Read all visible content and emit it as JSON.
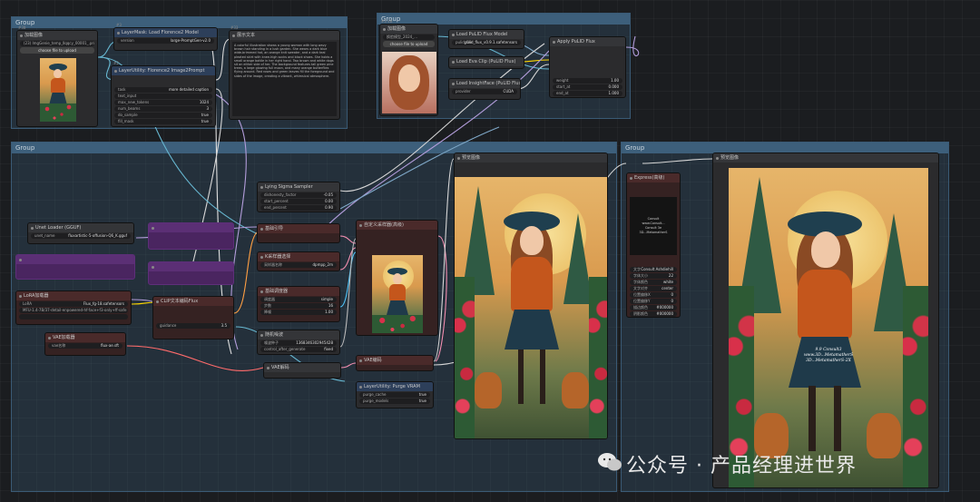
{
  "groups": {
    "top_left": "Group",
    "top_right": "Group",
    "bottom_left": "Group",
    "bottom_right": "Group"
  },
  "nodes": {
    "load_image": {
      "id": "#38",
      "title": "加载图像",
      "file": "(23) ImgGenie_temp_Ⅱqqcy_00001_.png",
      "upload": "choose file to upload"
    },
    "layermask_model": {
      "id": "#3",
      "title": "LayerMask: Load Florence2 Model",
      "label": "version",
      "value": "large-PromptGen-v2.0"
    },
    "florence_prompt": {
      "id": "#2",
      "title": "LayerUtility: Florence2 Image2Prompt",
      "rows": [
        [
          "task",
          "more detailed caption"
        ],
        [
          "text_input",
          ""
        ],
        [
          "max_new_tokens",
          "1024"
        ],
        [
          "num_beams",
          "3"
        ],
        [
          "do_sample",
          "true"
        ],
        [
          "fill_mask",
          "true"
        ]
      ]
    },
    "show_text": {
      "id": "#33",
      "title": "展示文本",
      "text": "A colorful illustration shows a young woman with long wavy brown hair standing in a lush garden. She wears a dark blue wide-brimmed hat, an orange knit sweater, and a dark teal pleated skirt with knee-high socks and black shoes. She holds a small orange bottle in her right hand. Two brown and white dogs sit on either side of her. The background features tall green pine trees, a large glowing full moon, and many orange butterflies flying around. Red roses and green leaves fill the foreground and sides of the image, creating a vibrant, whimsical atmosphere."
    },
    "load_image_2": {
      "id": "#3 4B",
      "title": "加载图像",
      "file": "换脸模型_2024_...",
      "upload": "choose file to upload"
    },
    "pulid_model": {
      "id": "#3 4B",
      "title": "Load PuLID Flux Model",
      "label": "pulid_file",
      "value": "pulid_flux_v0.9.1.safetensors"
    },
    "eva_clip": {
      "id": "#46 4B",
      "title": "Load Eva Clip (PuLID Flux)"
    },
    "insightface": {
      "id": "#3 8B",
      "title": "Load InsightFace (PuLID Flux)",
      "label": "provider",
      "value": "CUDA"
    },
    "apply_pulid": {
      "id": "#7 5B",
      "title": "Apply PuLID Flux",
      "rows": [
        [
          "weight",
          "1.00"
        ],
        [
          "start_at",
          "0.000"
        ],
        [
          "end_at",
          "1.000"
        ]
      ]
    },
    "unet_loader": {
      "id": "#1 1 4B",
      "title": "Unet Loader (GGUF)",
      "label": "unet_name",
      "value": "fluxartistic-5-offusion-Q6_K.gguf"
    },
    "lora": {
      "id": "#1 5 4B",
      "title": "LoRA加载器",
      "rows": [
        [
          "LoRA",
          "Flux_fg-18.safetensors"
        ],
        [
          "strength",
          "MFU-1.4-7B/37-detail-enpowered-hf-face+f3-only+ff-safe"
        ],
        [
          "",
          ""
        ]
      ]
    },
    "vae_loader": {
      "id": "#1 0 4B",
      "title": "VAE加载器",
      "label": "vae名称",
      "value": "flux-ae.sft"
    },
    "clip_encode": {
      "id": "#1 2 3B",
      "title": "CLIP文本编码Flux",
      "rows": [
        [
          "guidance",
          "3.5"
        ]
      ]
    },
    "sigma_sampler": {
      "id": "#3 4B",
      "title": "Lying Sigma Sampler",
      "rows": [
        [
          "dishonesty_factor",
          "-0.05"
        ],
        [
          "start_percent",
          "0.00"
        ],
        [
          "end_percent",
          "0.90"
        ]
      ]
    },
    "guide": {
      "id": "#1 3 4B",
      "title": "基础引导"
    },
    "ksampler_select": {
      "id": "#1 4 4B",
      "title": "K采样器选择",
      "label": "采样器名称",
      "value": "dpmpp_2m"
    },
    "basic_scheduler": {
      "id": "#1 2 4B",
      "title": "基础调度器",
      "rows": [
        [
          "调度器",
          "simple"
        ],
        [
          "步数",
          "16"
        ],
        [
          "降噪",
          "1.00"
        ]
      ]
    },
    "random_noise": {
      "id": "#1 7 4B",
      "title": "随机噪波",
      "rows": [
        [
          "噪波种子",
          "1368346302945428"
        ],
        [
          "control_after_generate",
          "fixed"
        ]
      ]
    },
    "vae_decode": {
      "id": "#7 7 4B",
      "title": "VAE解码"
    },
    "custom_sampler": {
      "id": "#1 1 4B",
      "title": "自定义采样器(高级)"
    },
    "vae_encode": {
      "id": "#1 8 4B",
      "title": "VAE编码"
    },
    "purge_vram": {
      "id": "#1 8 4B",
      "title": "LayerUtility: Purge VRAM",
      "rows": [
        [
          "purge_cache",
          "true"
        ],
        [
          "purge_models",
          "true"
        ]
      ]
    },
    "preview_1": {
      "id": "#1 0 4B",
      "title": "预览图像"
    },
    "easyuse": {
      "id": "#1 8 2B",
      "title": "Express(高级)",
      "rows": [
        [
          "文字",
          "Consult Ashdiehill"
        ],
        [
          "字体大小",
          "22"
        ],
        [
          "字体颜色",
          "white"
        ],
        [
          "文字对齐",
          "center"
        ],
        [
          "位置偏移X",
          "0"
        ],
        [
          "位置偏移Y",
          "0"
        ],
        [
          "描边颜色",
          "#000000"
        ],
        [
          "阴影颜色",
          "#000000"
        ]
      ],
      "preview_lines": [
        "Consult",
        "www.Consult...",
        "Consult 3e",
        "3D...MetamatherS",
        "3D..."
      ]
    },
    "preview_2": {
      "id": "#5 6 4B",
      "title": "预览图像"
    }
  },
  "overlay_text": [
    "9.9 Consult3",
    "www.3D...MetamatherS",
    "3D...MetamatherS-2X"
  ],
  "watermark": "公众号 · 产品经理进世界",
  "colors": {
    "group": "#3d5f7b",
    "canvas": "#1b1d20",
    "node": "#2b2b2d",
    "dark_node": "#352222",
    "purple_node": "#4a2560"
  }
}
